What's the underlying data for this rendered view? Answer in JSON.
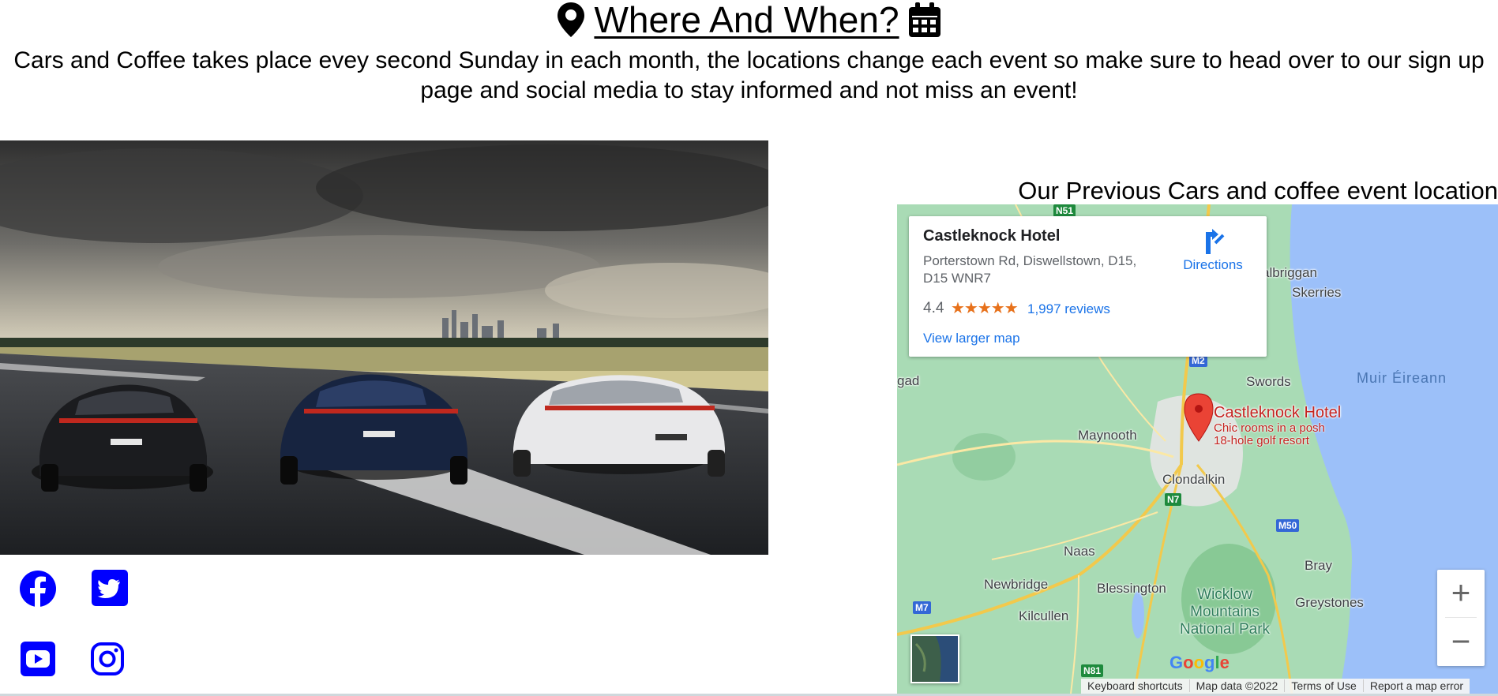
{
  "section": {
    "title": "Where And When?",
    "description": "Cars and Coffee takes place evey second Sunday in each month, the locations change each event so make sure to head over to our sign up page and social media to stay informed and not miss an event!",
    "icons": [
      "map-marker-icon",
      "calendar-icon"
    ]
  },
  "hero_image": {
    "description_icon": "porsche-cars-runway-photo"
  },
  "social": {
    "links": [
      {
        "name": "facebook",
        "icon": "facebook-icon"
      },
      {
        "name": "twitter",
        "icon": "twitter-icon"
      },
      {
        "name": "youtube",
        "icon": "youtube-icon"
      },
      {
        "name": "instagram",
        "icon": "instagram-icon"
      }
    ],
    "color": "#0000ff"
  },
  "map_section": {
    "title": "Our Previous Cars and coffee event location",
    "card": {
      "place_name": "Castleknock Hotel",
      "address": "Porterstown Rd, Diswellstown, D15, D15 WNR7",
      "rating": "4.4",
      "stars": "★★★★★",
      "star_fill_fraction": 0.88,
      "reviews": "1,997 reviews",
      "view_larger": "View larger map",
      "directions": "Directions"
    },
    "pin": {
      "label": "Castleknock Hotel",
      "desc_line1": "Chic rooms in a posh",
      "desc_line2": "18-hole golf resort"
    },
    "places": {
      "balbriggan": "albriggan",
      "skerries": "Skerries",
      "swords": "Swords",
      "muir": "Muir Éireann",
      "maynooth": "Maynooth",
      "clondalkin": "Clondalkin",
      "naas": "Naas",
      "newbridge": "Newbridge",
      "blessington": "Blessington",
      "kilcullen": "Kilcullen",
      "bray": "Bray",
      "greystones": "Greystones",
      "wicklow": "Wicklow Mountains National Park",
      "edenderry": "gad"
    },
    "roads": {
      "n51": "N51",
      "m2": "M2",
      "n7": "N7",
      "m50": "M50",
      "m7": "M7",
      "n81": "N81"
    },
    "zoom_in": "+",
    "zoom_out": "−",
    "google": "Google",
    "attribution": [
      "Keyboard shortcuts",
      "Map data ©2022",
      "Terms of Use",
      "Report a map error"
    ]
  }
}
